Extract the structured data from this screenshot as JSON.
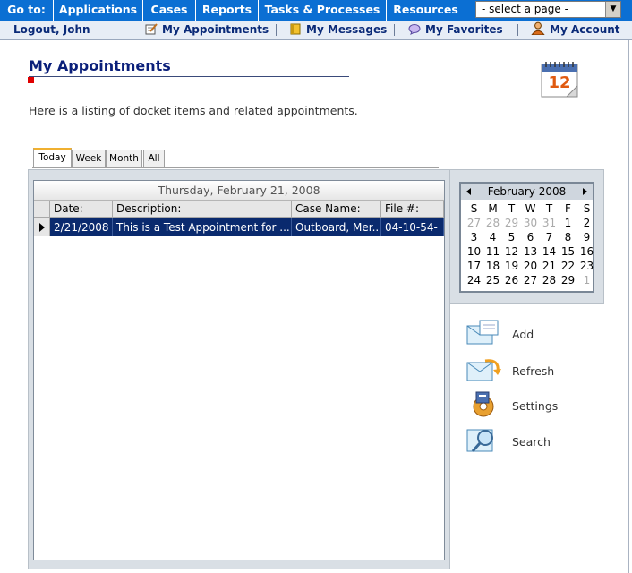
{
  "topnav": {
    "goto_label": "Go to:",
    "items": [
      "Applications",
      "Cases",
      "Reports",
      "Tasks & Processes",
      "Resources"
    ],
    "page_select_value": "- select a page -"
  },
  "subnav": {
    "logout": "Logout, John",
    "appointments": "My Appointments",
    "messages": "My Messages",
    "favorites": "My Favorites",
    "account": "My Account"
  },
  "page": {
    "title": "My Appointments",
    "intro": "Here is a listing of docket items and related appointments.",
    "calendar_icon_day": "12"
  },
  "tabs": [
    "Today",
    "Week",
    "Month",
    "All"
  ],
  "grid": {
    "caption": "Thursday, February 21, 2008",
    "columns": [
      "Date:",
      "Description:",
      "Case Name:",
      "File #:"
    ],
    "rows": [
      [
        "2/21/2008",
        "This is a Test Appointment for ...",
        "Outboard, Mer...",
        "04-10-54-"
      ]
    ]
  },
  "calendar": {
    "month_label": "February 2008",
    "weekdays": [
      "S",
      "M",
      "T",
      "W",
      "T",
      "F",
      "S"
    ],
    "weeks": [
      [
        {
          "d": "27",
          "o": true
        },
        {
          "d": "28",
          "o": true
        },
        {
          "d": "29",
          "o": true
        },
        {
          "d": "30",
          "o": true
        },
        {
          "d": "31",
          "o": true
        },
        {
          "d": "1",
          "o": false
        },
        {
          "d": "2",
          "o": false
        }
      ],
      [
        {
          "d": "3",
          "o": false
        },
        {
          "d": "4",
          "o": false
        },
        {
          "d": "5",
          "o": false
        },
        {
          "d": "6",
          "o": false
        },
        {
          "d": "7",
          "o": false
        },
        {
          "d": "8",
          "o": false
        },
        {
          "d": "9",
          "o": false
        }
      ],
      [
        {
          "d": "10",
          "o": false
        },
        {
          "d": "11",
          "o": false
        },
        {
          "d": "12",
          "o": false
        },
        {
          "d": "13",
          "o": false
        },
        {
          "d": "14",
          "o": false
        },
        {
          "d": "15",
          "o": false
        },
        {
          "d": "16",
          "o": false
        }
      ],
      [
        {
          "d": "17",
          "o": false
        },
        {
          "d": "18",
          "o": false
        },
        {
          "d": "19",
          "o": false
        },
        {
          "d": "20",
          "o": false
        },
        {
          "d": "21",
          "o": false
        },
        {
          "d": "22",
          "o": false
        },
        {
          "d": "23",
          "o": false
        }
      ],
      [
        {
          "d": "24",
          "o": false
        },
        {
          "d": "25",
          "o": false
        },
        {
          "d": "26",
          "o": false
        },
        {
          "d": "27",
          "o": false
        },
        {
          "d": "28",
          "o": false
        },
        {
          "d": "29",
          "o": false
        },
        {
          "d": "1",
          "o": true
        }
      ]
    ]
  },
  "actions": {
    "add": "Add",
    "refresh": "Refresh",
    "settings": "Settings",
    "search": "Search"
  },
  "colors": {
    "nav_blue": "#0b6fd3",
    "selected_row": "#0a2a6e",
    "title": "#0a1f7a"
  }
}
